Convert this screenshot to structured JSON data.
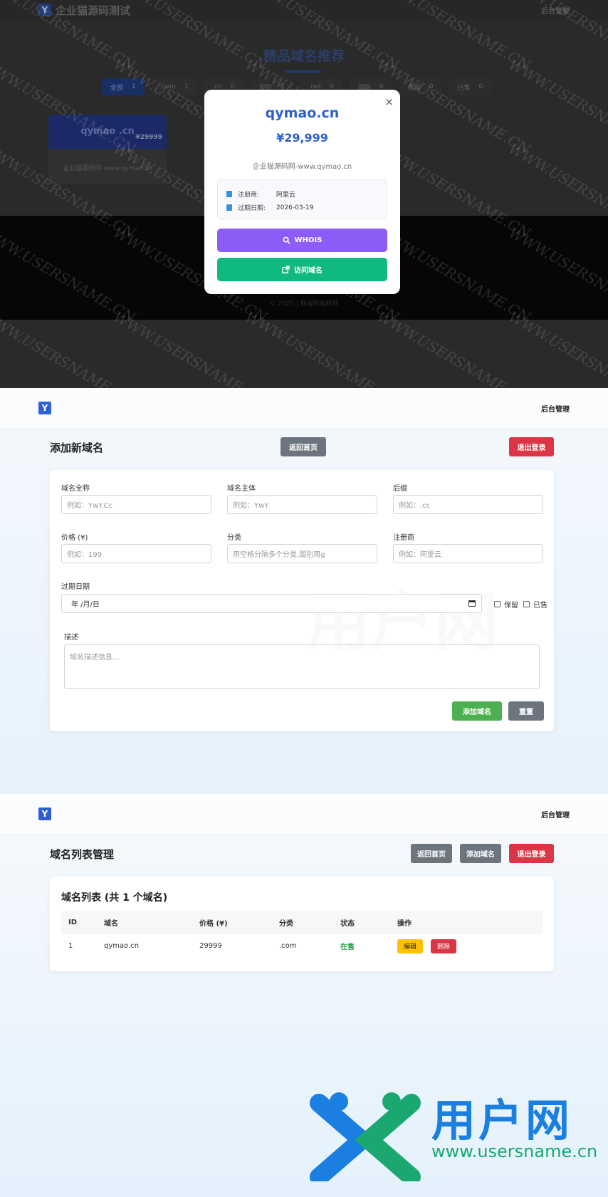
{
  "storefront": {
    "site_title": "企业猫源码测试",
    "nav_right": "后台管理",
    "section_title": "精品域名推荐",
    "filters": [
      {
        "label": "全部",
        "count": "1"
      },
      {
        "label": ".com",
        "count": "1"
      },
      {
        "label": ".cn",
        "count": "0"
      },
      {
        "label": "双拼",
        "count": "0"
      },
      {
        "label": ".net",
        "count": "0"
      },
      {
        "label": "国际",
        "count": "0"
      },
      {
        "label": "保留",
        "count": "0"
      },
      {
        "label": "已售",
        "count": "0"
      }
    ],
    "card": {
      "name": "qymao .cn",
      "price": "¥29999",
      "desc": "企业猫源码网-www.qymao.cn"
    },
    "copyright": "© 2025 | 保留所有权利"
  },
  "modal": {
    "close": "×",
    "domain": "qymao.cn",
    "price": "¥29,999",
    "desc": "企业猫源码网-www.qymao.cn",
    "registrar_label": "注册商:",
    "registrar": "阿里云",
    "expiry_label": "过期日期:",
    "expiry": "2026-03-19",
    "whois_label": "WHOIS",
    "visit_label": "访问域名"
  },
  "watermark": "WWW.USERSNAME.CN",
  "add_page": {
    "logo": "Y",
    "nav_right": "后台管理",
    "title": "添加新域名",
    "back_home": "返回首页",
    "logout": "退出登录",
    "fields": {
      "full_label": "域名全称",
      "full_ph": "例如：YwY.Cc",
      "main_label": "域名主体",
      "main_ph": "例如：YwY",
      "suffix_label": "后缀",
      "suffix_ph": "例如：.cc",
      "price_label": "价格 (¥)",
      "price_ph": "例如：199",
      "cat_label": "分类",
      "cat_ph": "用空格分隔多个分类,国别用g",
      "reg_label": "注册商",
      "reg_ph": "例如：阿里云",
      "expiry_label": "过期日期",
      "expiry_value": "年 /月/日",
      "reserve_label": "保留",
      "sold_label": "已售",
      "desc_label": "描述",
      "desc_ph": "域名描述信息..."
    },
    "add_btn": "添加域名",
    "reset_btn": "重置",
    "bg_brand": "用户网"
  },
  "list_page": {
    "logo": "Y",
    "nav_right": "后台管理",
    "title": "域名列表管理",
    "back_home": "返回首页",
    "add_domain": "添加域名",
    "logout": "退出登录",
    "list_title": "域名列表 (共 1 个域名)",
    "columns": [
      "ID",
      "域名",
      "价格 (¥)",
      "分类",
      "状态",
      "操作"
    ],
    "rows": [
      {
        "id": "1",
        "domain": "qymao.cn",
        "price": "29999",
        "category": ".com",
        "status": "在售",
        "edit": "编辑",
        "delete": "删除"
      }
    ]
  },
  "brand": {
    "cn": "用户网",
    "url": "www.usersname.cn"
  },
  "colors": {
    "primary": "#2c5fd0",
    "whois": "#8b5cf6",
    "visit": "#10b981",
    "danger": "#dc3545",
    "success": "#4caf50"
  }
}
